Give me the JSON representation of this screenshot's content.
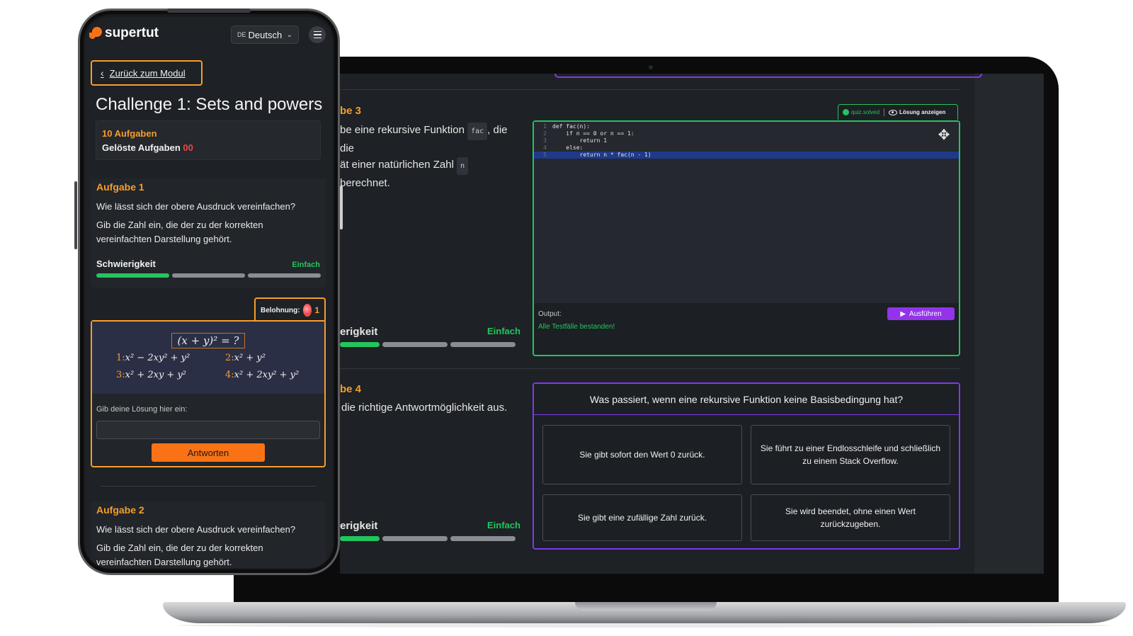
{
  "laptop": {
    "task3": {
      "title": "be 3",
      "line1_pre": "be eine rekursive Funktion",
      "code_fn": "fac",
      "line1_post": ", die die",
      "line2_pre": "ät einer natürlichen Zahl",
      "code_n": "n",
      "line2_post": "berechnet.",
      "difficulty_label": "erigkeit",
      "difficulty_value": "Einfach",
      "difficulty_level": "1/3"
    },
    "editor": {
      "solved_label": "quiz.solved",
      "show_solution_label": "Lösung anzeigen",
      "code_lines": [
        {
          "num": "1",
          "text": "def fac(n):"
        },
        {
          "num": "2",
          "text": "    if n == 0 or n == 1:"
        },
        {
          "num": "3",
          "text": "        return 1"
        },
        {
          "num": "4",
          "text": "    else:"
        },
        {
          "num": "5",
          "text": "        return n * fac(n - 1)"
        }
      ],
      "output_label": "Output:",
      "output_text": "Alle Testfälle bestanden!",
      "run_label": "Ausführen",
      "accent": "#22c55e"
    },
    "task4": {
      "title": "be 4",
      "text": "die richtige Antwortmöglichkeit aus.",
      "difficulty_label": "erigkeit",
      "difficulty_value": "Einfach",
      "difficulty_level": "1/3"
    },
    "quiz": {
      "question": "Was passiert, wenn eine rekursive Funktion keine Basisbedingung hat?",
      "options": [
        "Sie gibt sofort den Wert 0 zurück.",
        "Sie führt zu einer Endlosschleife und schließlich zu einem Stack Overflow.",
        "Sie gibt eine zufällige Zahl zurück.",
        "Sie wird beendet, ohne einen Wert zurückzugeben."
      ],
      "accent": "#7c3aed"
    }
  },
  "phone": {
    "brand": "supertut",
    "language_code": "DE",
    "language": "Deutsch",
    "back_label": "Zurück zum Modul",
    "page_title": "Challenge 1: Sets and powers",
    "tasks_count": "10 Aufgaben",
    "solved_label": "Gelöste Aufgaben",
    "solved_count": "00",
    "task1": {
      "title": "Aufgabe 1",
      "question": "Wie lässt sich der obere Ausdruck vereinfachen?",
      "instruction": "Gib die Zahl ein, die der zu der korrekten vereinfachten Darstellung gehört.",
      "difficulty_label": "Schwierigkeit",
      "difficulty_value": "Einfach",
      "difficulty_level": "1/3"
    },
    "reward_label": "Belohnung:",
    "reward_value": "1",
    "formula": {
      "main": "(x + y)² = ?",
      "options": [
        {
          "num": "1:",
          "expr": "x² − 2xy² + y²"
        },
        {
          "num": "2:",
          "expr": "x² + y²"
        },
        {
          "num": "3:",
          "expr": "x² + 2xy + y²"
        },
        {
          "num": "4:",
          "expr": "x² + 2xy² + y²"
        }
      ]
    },
    "solution_label": "Gib deine Lösung hier ein:",
    "solution_value": "",
    "submit_label": "Antworten",
    "task2": {
      "title": "Aufgabe 2",
      "question": "Wie lässt sich der obere Ausdruck vereinfachen?",
      "instruction": "Gib die Zahl ein, die der zu der korrekten vereinfachten Darstellung gehört."
    },
    "accent": "#f59e2b"
  }
}
